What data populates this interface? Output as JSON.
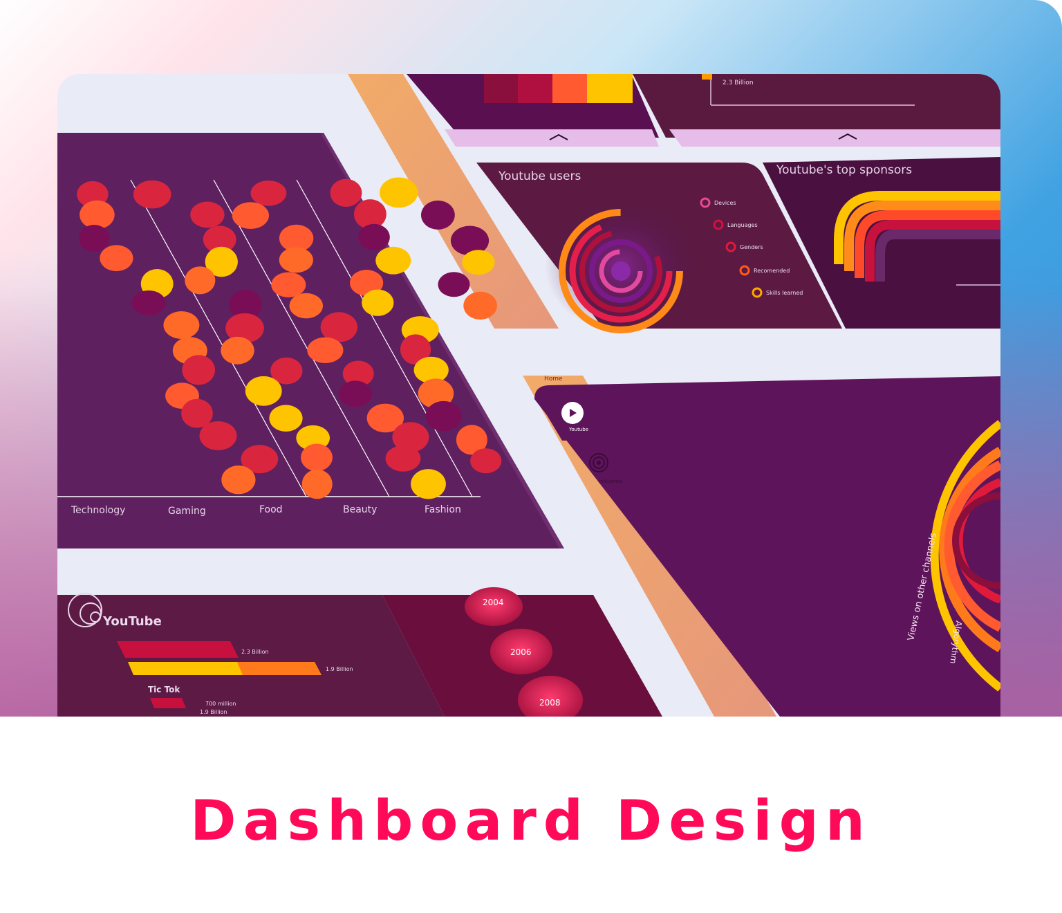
{
  "caption": "Dashboard Design",
  "category_chart": {
    "categories": [
      "Technology",
      "Gaming",
      "Food",
      "Beauty",
      "Fashion"
    ]
  },
  "users_panel": {
    "title": "Youtube users",
    "legend": [
      "Devices",
      "Languages",
      "Genders",
      "Recomended",
      "Skills learned"
    ]
  },
  "sponsors_panel": {
    "title": "Youtube's top sponsors"
  },
  "top_axis": {
    "value_label": "2.3 Billion"
  },
  "nav": {
    "home": "Home",
    "youtube": "Youtube",
    "industries": "Industries"
  },
  "big_arc": {
    "outer_label": "Views on other channels",
    "inner_label": "Algorythm"
  },
  "compare_panel": {
    "logo_text": "YouTube",
    "youtube_bar1": "2.3 Billion",
    "youtube_bar2": "1.9 Billion",
    "tiktok_title": "Tic Tok",
    "tiktok_bar1": "700 million",
    "tiktok_bar2": "1.9 Billion"
  },
  "timeline": [
    "2004",
    "2006",
    "2008"
  ],
  "colors": {
    "accent": "#ff0a59",
    "purple": "#5f1a5a",
    "yellow": "#ffc400",
    "orange": "#ff5a30",
    "red": "#d9263e",
    "plum": "#7a0e56",
    "peach": "#eda46b"
  }
}
